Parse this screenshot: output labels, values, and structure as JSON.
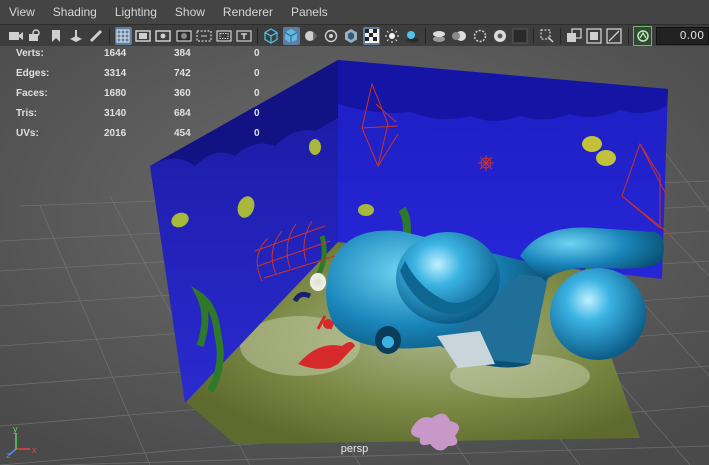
{
  "menus": [
    "View",
    "Shading",
    "Lighting",
    "Show",
    "Renderer",
    "Panels"
  ],
  "toolbar": {
    "icons": [
      "camera-icon",
      "camera-attributes-icon",
      "bookmark-icon",
      "image-plane-icon",
      "pencil-icon",
      "grid-icon",
      "film-gate-icon",
      "resolution-gate-icon",
      "gate-mask-icon",
      "field-chart-icon",
      "safe-action-icon",
      "safe-title-icon",
      "wireframe-icon",
      "smooth-shade-icon",
      "default-material-icon",
      "xray-icon",
      "textured-icon",
      "lights-icon",
      "shadows-icon",
      "ambient-occlusion-icon",
      "motion-blur-icon",
      "anti-alias-icon",
      "depth-of-field-icon",
      "isolate-select-icon",
      "xray-joints-icon",
      "xray-active-icon",
      "backface-icon",
      "exposure-icon"
    ],
    "exposure_value": "0.00"
  },
  "hud": {
    "rows": [
      {
        "label": "Verts:",
        "c1": "1644",
        "c2": "384",
        "c3": "0"
      },
      {
        "label": "Edges:",
        "c1": "3314",
        "c2": "742",
        "c3": "0"
      },
      {
        "label": "Faces:",
        "c1": "1680",
        "c2": "360",
        "c3": "0"
      },
      {
        "label": "Tris:",
        "c1": "3140",
        "c2": "684",
        "c3": "0"
      },
      {
        "label": "UVs:",
        "c1": "2016",
        "c2": "454",
        "c3": "0"
      }
    ]
  },
  "viewport": {
    "camera": "persp",
    "axis_labels": {
      "x": "x",
      "y": "y",
      "z": "z"
    }
  },
  "colors": {
    "menubar": "#444444",
    "viewport_bg": "#5f5f5f",
    "wall_blue": "#1c1ab8",
    "submarine": "#1683b8",
    "floor": "#7c8a45",
    "accent_active": "#5d7ea2"
  }
}
